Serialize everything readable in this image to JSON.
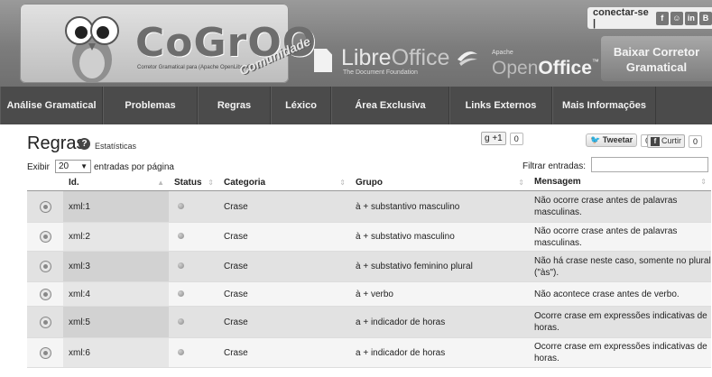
{
  "header": {
    "brand": "CoGrOO",
    "brand_subtitle": "Corretor Gramatical para (Apache OpenLibre)Office",
    "brand_tag": "Comunidade",
    "libreoffice_name_light": "Libre",
    "libreoffice_name_bold": "Office",
    "libreoffice_sub": "The Document Foundation",
    "apache_top": "Apache",
    "apache_open": "Open",
    "apache_office": "Office",
    "apache_tm": "™",
    "connect_label": "conectar-se |",
    "social_icons": [
      "facebook-icon",
      "github-icon",
      "linkedin-icon",
      "blog-icon"
    ],
    "download_line1": "Baixar Corretor",
    "download_line2": "Gramatical"
  },
  "nav": [
    {
      "label": "Análise Gramatical"
    },
    {
      "label": "Problemas"
    },
    {
      "label": "Regras"
    },
    {
      "label": "Léxico"
    },
    {
      "label": "Área Exclusiva"
    },
    {
      "label": "Links Externos"
    },
    {
      "label": "Mais Informações"
    }
  ],
  "page": {
    "title": "Regras",
    "help_icon": "?",
    "stats_link": "Estatísticas",
    "gplus_label": "+1",
    "gplus_count": "0",
    "tweet_label": "Tweetar",
    "tweet_count": "0",
    "like_label": "Curtir",
    "like_count": "0"
  },
  "controls": {
    "show_label": "Exibir",
    "page_length": "20",
    "show_suffix": "entradas por página",
    "filter_label": "Filtrar entradas:",
    "filter_value": ""
  },
  "table": {
    "columns": [
      "Id.",
      "Status",
      "Categoria",
      "Grupo",
      "Mensagem"
    ],
    "rows": [
      {
        "id": "xml:1",
        "categoria": "Crase",
        "grupo": "à + substantivo masculino",
        "mensagem": "Não ocorre crase antes de palavras masculinas."
      },
      {
        "id": "xml:2",
        "categoria": "Crase",
        "grupo": "à + substativo masculino",
        "mensagem": "Não ocorre crase antes de palavras masculinas."
      },
      {
        "id": "xml:3",
        "categoria": "Crase",
        "grupo": "à + substativo feminino plural",
        "mensagem": "Não há crase neste caso, somente no plural (\"às\")."
      },
      {
        "id": "xml:4",
        "categoria": "Crase",
        "grupo": "à + verbo",
        "mensagem": "Não acontece crase antes de verbo."
      },
      {
        "id": "xml:5",
        "categoria": "Crase",
        "grupo": "a + indicador de horas",
        "mensagem": "Ocorre crase em expressões indicativas de horas."
      },
      {
        "id": "xml:6",
        "categoria": "Crase",
        "grupo": "a + indicador de horas",
        "mensagem": "Ocorre crase em expressões indicativas de horas."
      }
    ]
  }
}
